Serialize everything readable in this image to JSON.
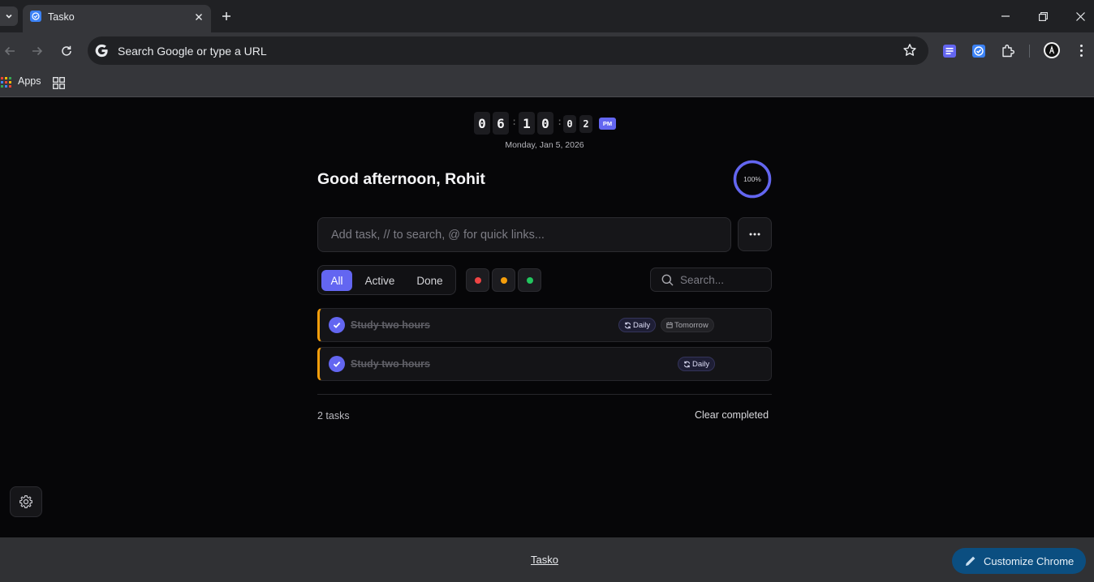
{
  "browser": {
    "tab_title": "Tasko",
    "omnibox_placeholder": "Search Google or type a URL",
    "bookmarks": {
      "apps_label": "Apps"
    }
  },
  "clock": {
    "hour_digits": [
      "0",
      "6"
    ],
    "minute_digits": [
      "1",
      "0"
    ],
    "second_digits": [
      "0",
      "2"
    ],
    "separator": ":",
    "ampm": "PM",
    "date": "Monday, Jan 5, 2026"
  },
  "greeting": "Good afternoon, Rohit",
  "progress": {
    "label": "100%",
    "value": 100
  },
  "add_task": {
    "placeholder": "Add task, // to search, @ for quick links..."
  },
  "filters": {
    "tabs": [
      {
        "label": "All",
        "active": true
      },
      {
        "label": "Active",
        "active": false
      },
      {
        "label": "Done",
        "active": false
      }
    ],
    "priority_colors": [
      "#ef4444",
      "#f59e0b",
      "#22c55e"
    ]
  },
  "search": {
    "placeholder": "Search..."
  },
  "tasks": [
    {
      "text": "Study two hours",
      "completed": true,
      "repeat": "Daily",
      "due": "Tomorrow",
      "priority_color": "#f59e0b"
    },
    {
      "text": "Study two hours",
      "completed": true,
      "repeat": "Daily",
      "priority_color": "#f59e0b"
    }
  ],
  "footer_stats": {
    "count": "2 tasks",
    "clear_label": "Clear completed"
  },
  "footer": {
    "link": "Tasko",
    "customize_label": "Customize Chrome"
  },
  "colors": {
    "accent": "#6366f1",
    "page_bg": "#060608",
    "customize_bg": "#0b4e80"
  }
}
